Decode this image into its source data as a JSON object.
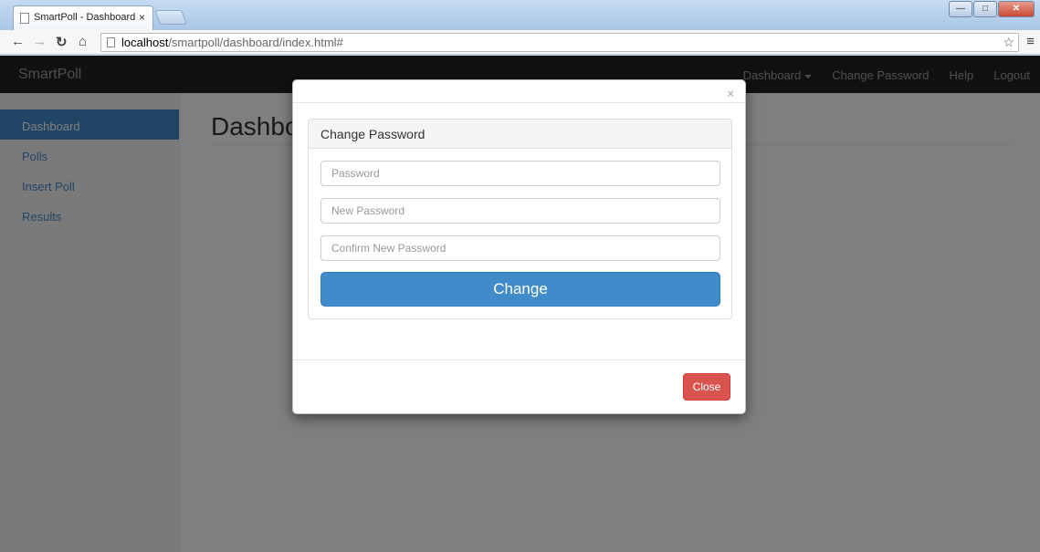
{
  "browser": {
    "tab_title": "SmartPoll - Dashboard",
    "tab_close": "×",
    "url_host": "localhost",
    "url_path": "/smartpoll/dashboard/index.html#"
  },
  "navbar": {
    "brand": "SmartPoll",
    "links": {
      "dashboard": "Dashboard",
      "change_password": "Change Password",
      "help": "Help",
      "logout": "Logout"
    }
  },
  "sidebar": {
    "items": [
      "Dashboard",
      "Polls",
      "Insert Poll",
      "Results"
    ],
    "active_index": 0
  },
  "main": {
    "title": "Dashboard"
  },
  "modal": {
    "close_x": "×",
    "panel_title": "Change Password",
    "password_placeholder": "Password",
    "new_password_placeholder": "New Password",
    "confirm_password_placeholder": "Confirm New Password",
    "change_label": "Change",
    "close_label": "Close"
  },
  "colors": {
    "primary": "#428bca",
    "danger": "#d9534f",
    "navbar": "#222222"
  }
}
